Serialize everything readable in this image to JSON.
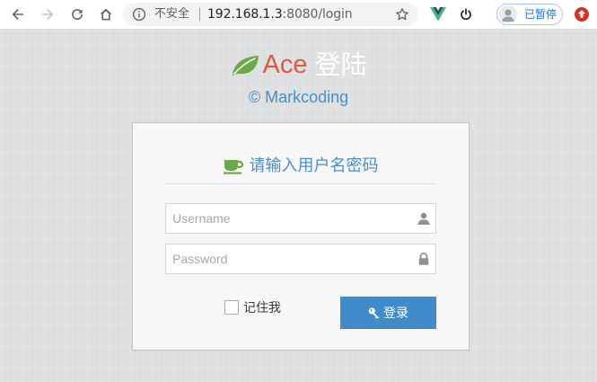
{
  "browser": {
    "security_label": "不安全",
    "url_host": "192.168.1.3",
    "url_path": ":8080/login",
    "profile_status": "已暂停"
  },
  "brand": {
    "name": "Ace",
    "title": "登陆",
    "copyright": "© Markcoding",
    "accent_color": "#dd5a43",
    "leaf_color": "#69aa46"
  },
  "login": {
    "heading": "请输入用户名密码",
    "username_placeholder": "Username",
    "username_value": "",
    "password_placeholder": "Password",
    "password_value": "",
    "remember_label": "记住我",
    "remember_checked": false,
    "submit_label": "登录",
    "button_color": "#428bca"
  },
  "icons": {
    "back": "arrow-left-icon",
    "forward": "arrow-right-icon",
    "reload": "reload-icon",
    "home": "home-icon",
    "site_info": "info-icon",
    "bookmark": "star-icon",
    "vue_devtools": "vue-logo-icon",
    "power": "power-icon",
    "update": "update-arrow-icon",
    "heading": "coffee-cup-icon",
    "username": "user-icon",
    "password": "lock-icon",
    "submit": "key-icon"
  }
}
